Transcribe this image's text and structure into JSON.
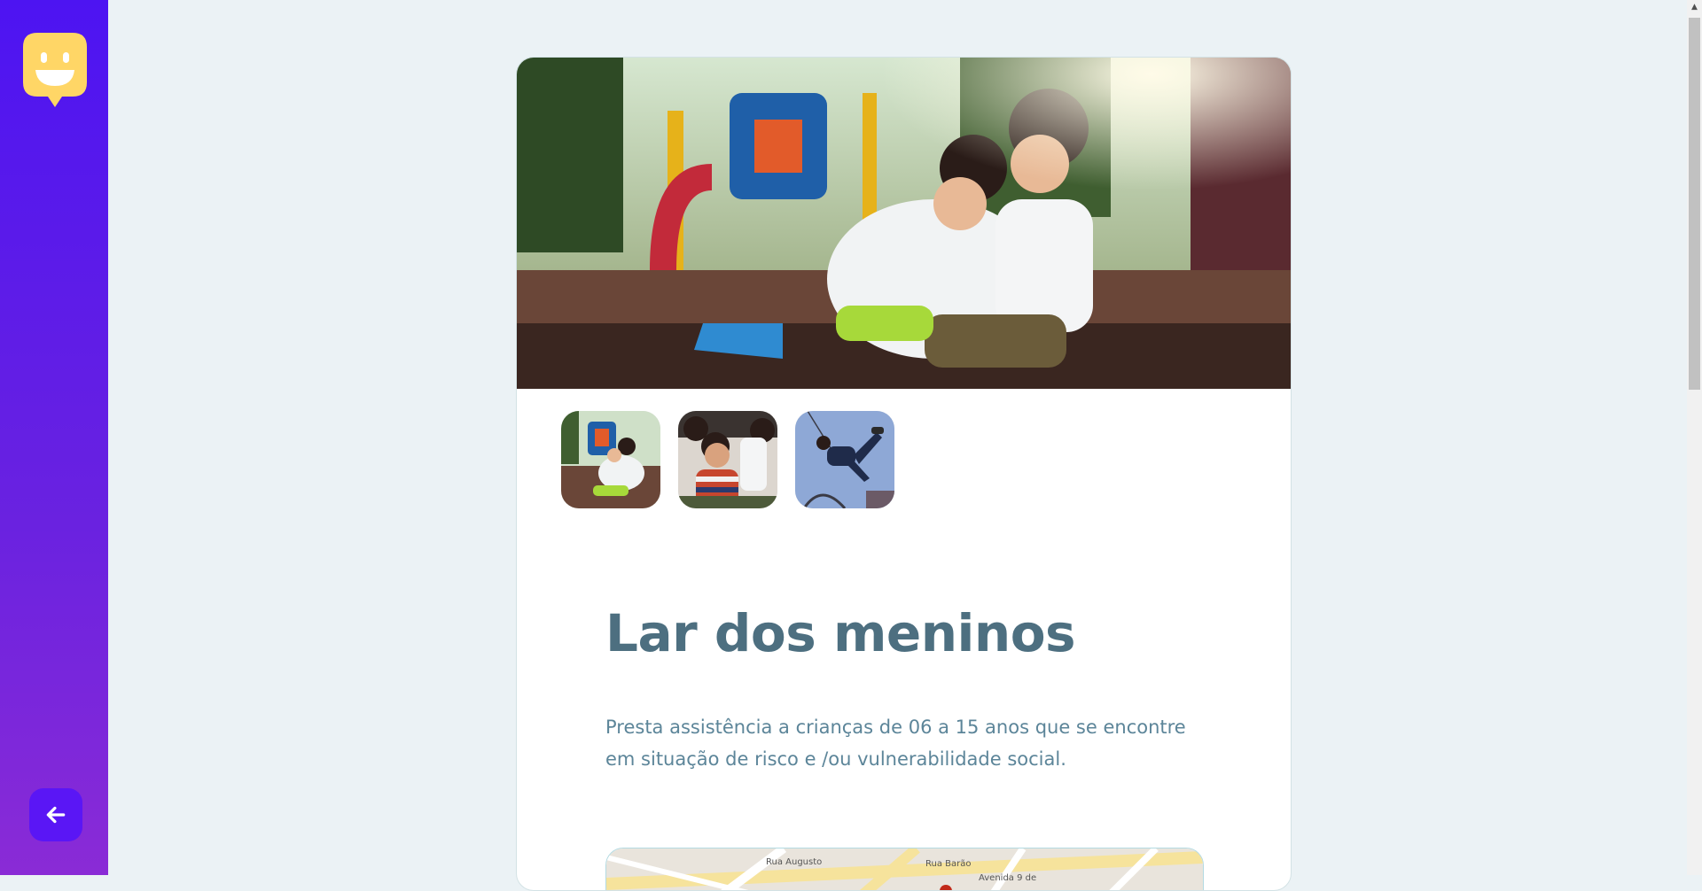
{
  "place": {
    "title": "Lar dos meninos",
    "description": "Presta assistência a crianças de 06 a 15 anos que se encontre em situação de risco e /ou vulnerabilidade social."
  },
  "gallery": {
    "hero_alt": "Duas crianças abraçadas sentadas em um parquinho",
    "thumbnails": [
      {
        "alt": "Crianças no parquinho"
      },
      {
        "alt": "Crianças brincando e sorrindo"
      },
      {
        "alt": "Criança pulando no balanço"
      }
    ]
  },
  "map": {
    "streets": [
      "Rua Barão",
      "Avenida 9 de",
      "Rua Augusto"
    ]
  },
  "colors": {
    "sidebar_top": "#4d14f2",
    "sidebar_bottom": "#8a2bd6",
    "logo_yellow": "#ffd666",
    "title": "#4d6f80",
    "text": "#5c8599",
    "background": "#ebf2f5"
  },
  "icons": {
    "logo": "smiley-map-marker-icon",
    "back": "arrow-left-icon"
  }
}
